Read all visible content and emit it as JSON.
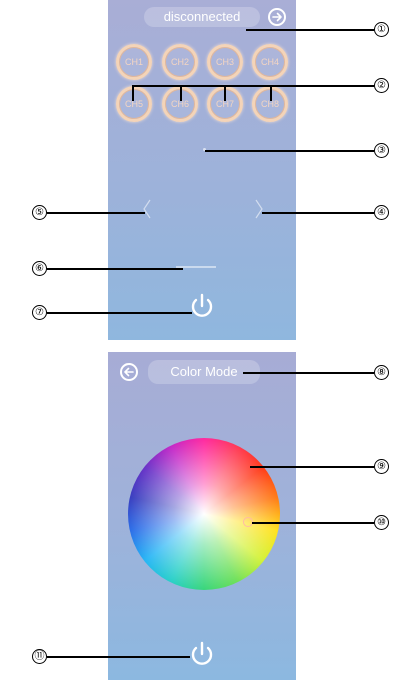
{
  "screen1": {
    "status": "disconnected",
    "status_icon": "arrow-right-circle-icon",
    "channels": [
      "CH1",
      "CH2",
      "CH3",
      "CH4",
      "CH5",
      "CH6",
      "CH7",
      "CH8"
    ],
    "power_icon": "power-icon"
  },
  "screen2": {
    "back_icon": "arrow-left-circle-icon",
    "mode_label": "Color Mode",
    "power_icon": "power-icon"
  },
  "callouts": [
    "①",
    "②",
    "③",
    "④",
    "⑤",
    "⑥",
    "⑦",
    "⑧",
    "⑨",
    "⑩",
    "⑪"
  ],
  "colors": {
    "screen_top": "#a9aed6",
    "screen_bottom": "#8fb7de",
    "channel_ring": "#f4d4b8",
    "channel_text": "#f3d5c2",
    "handle": "#ffb9a6"
  }
}
